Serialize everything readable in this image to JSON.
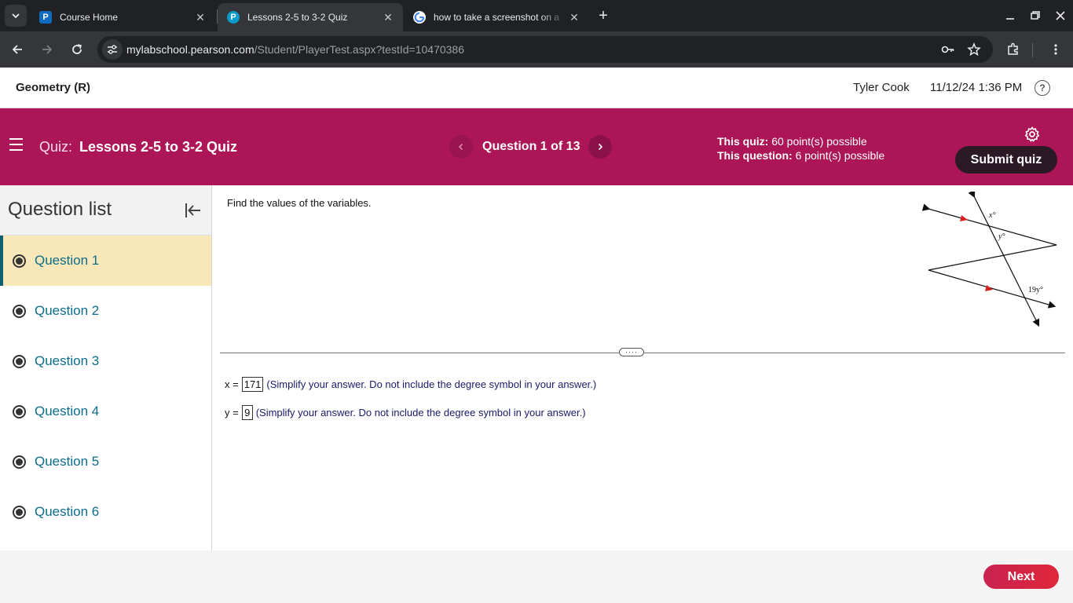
{
  "browser": {
    "tabs": [
      {
        "title": "Course Home",
        "favicon": "pearson-p-icon",
        "active": false
      },
      {
        "title": "Lessons 2-5 to 3-2 Quiz",
        "favicon": "pearson-p-icon",
        "active": true
      },
      {
        "title": "how to take a screenshot on a",
        "favicon": "google-g-icon",
        "active": false
      }
    ],
    "url_host": "mylabschool.pearson.com",
    "url_path": "/Student/PlayerTest.aspx?testId=10470386"
  },
  "header": {
    "course": "Geometry (R)",
    "user": "Tyler Cook",
    "datetime": "11/12/24 1:36 PM"
  },
  "quiz": {
    "label": "Quiz:",
    "name": "Lessons 2-5 to 3-2 Quiz",
    "counter": "Question 1 of 13",
    "quiz_points_label": "This quiz:",
    "quiz_points": "60 point(s) possible",
    "question_points_label": "This question:",
    "question_points": "6 point(s) possible",
    "submit_label": "Submit quiz",
    "accent_color": "#ac1656"
  },
  "sidebar": {
    "title": "Question list",
    "items": [
      {
        "label": "Question 1"
      },
      {
        "label": "Question 2"
      },
      {
        "label": "Question 3"
      },
      {
        "label": "Question 4"
      },
      {
        "label": "Question 5"
      },
      {
        "label": "Question 6"
      }
    ]
  },
  "question": {
    "instruction": "Find the values of the variables.",
    "figure_labels": {
      "x": "x°",
      "y": "y°",
      "z": "19y°"
    },
    "answers": [
      {
        "prefix": "x =",
        "value": "171",
        "note": "(Simplify your answer. Do not include the degree symbol in your answer.)"
      },
      {
        "prefix": "y =",
        "value": "9",
        "note": "(Simplify your answer. Do not include the degree symbol in your answer.)"
      }
    ]
  },
  "footer": {
    "next_label": "Next"
  }
}
